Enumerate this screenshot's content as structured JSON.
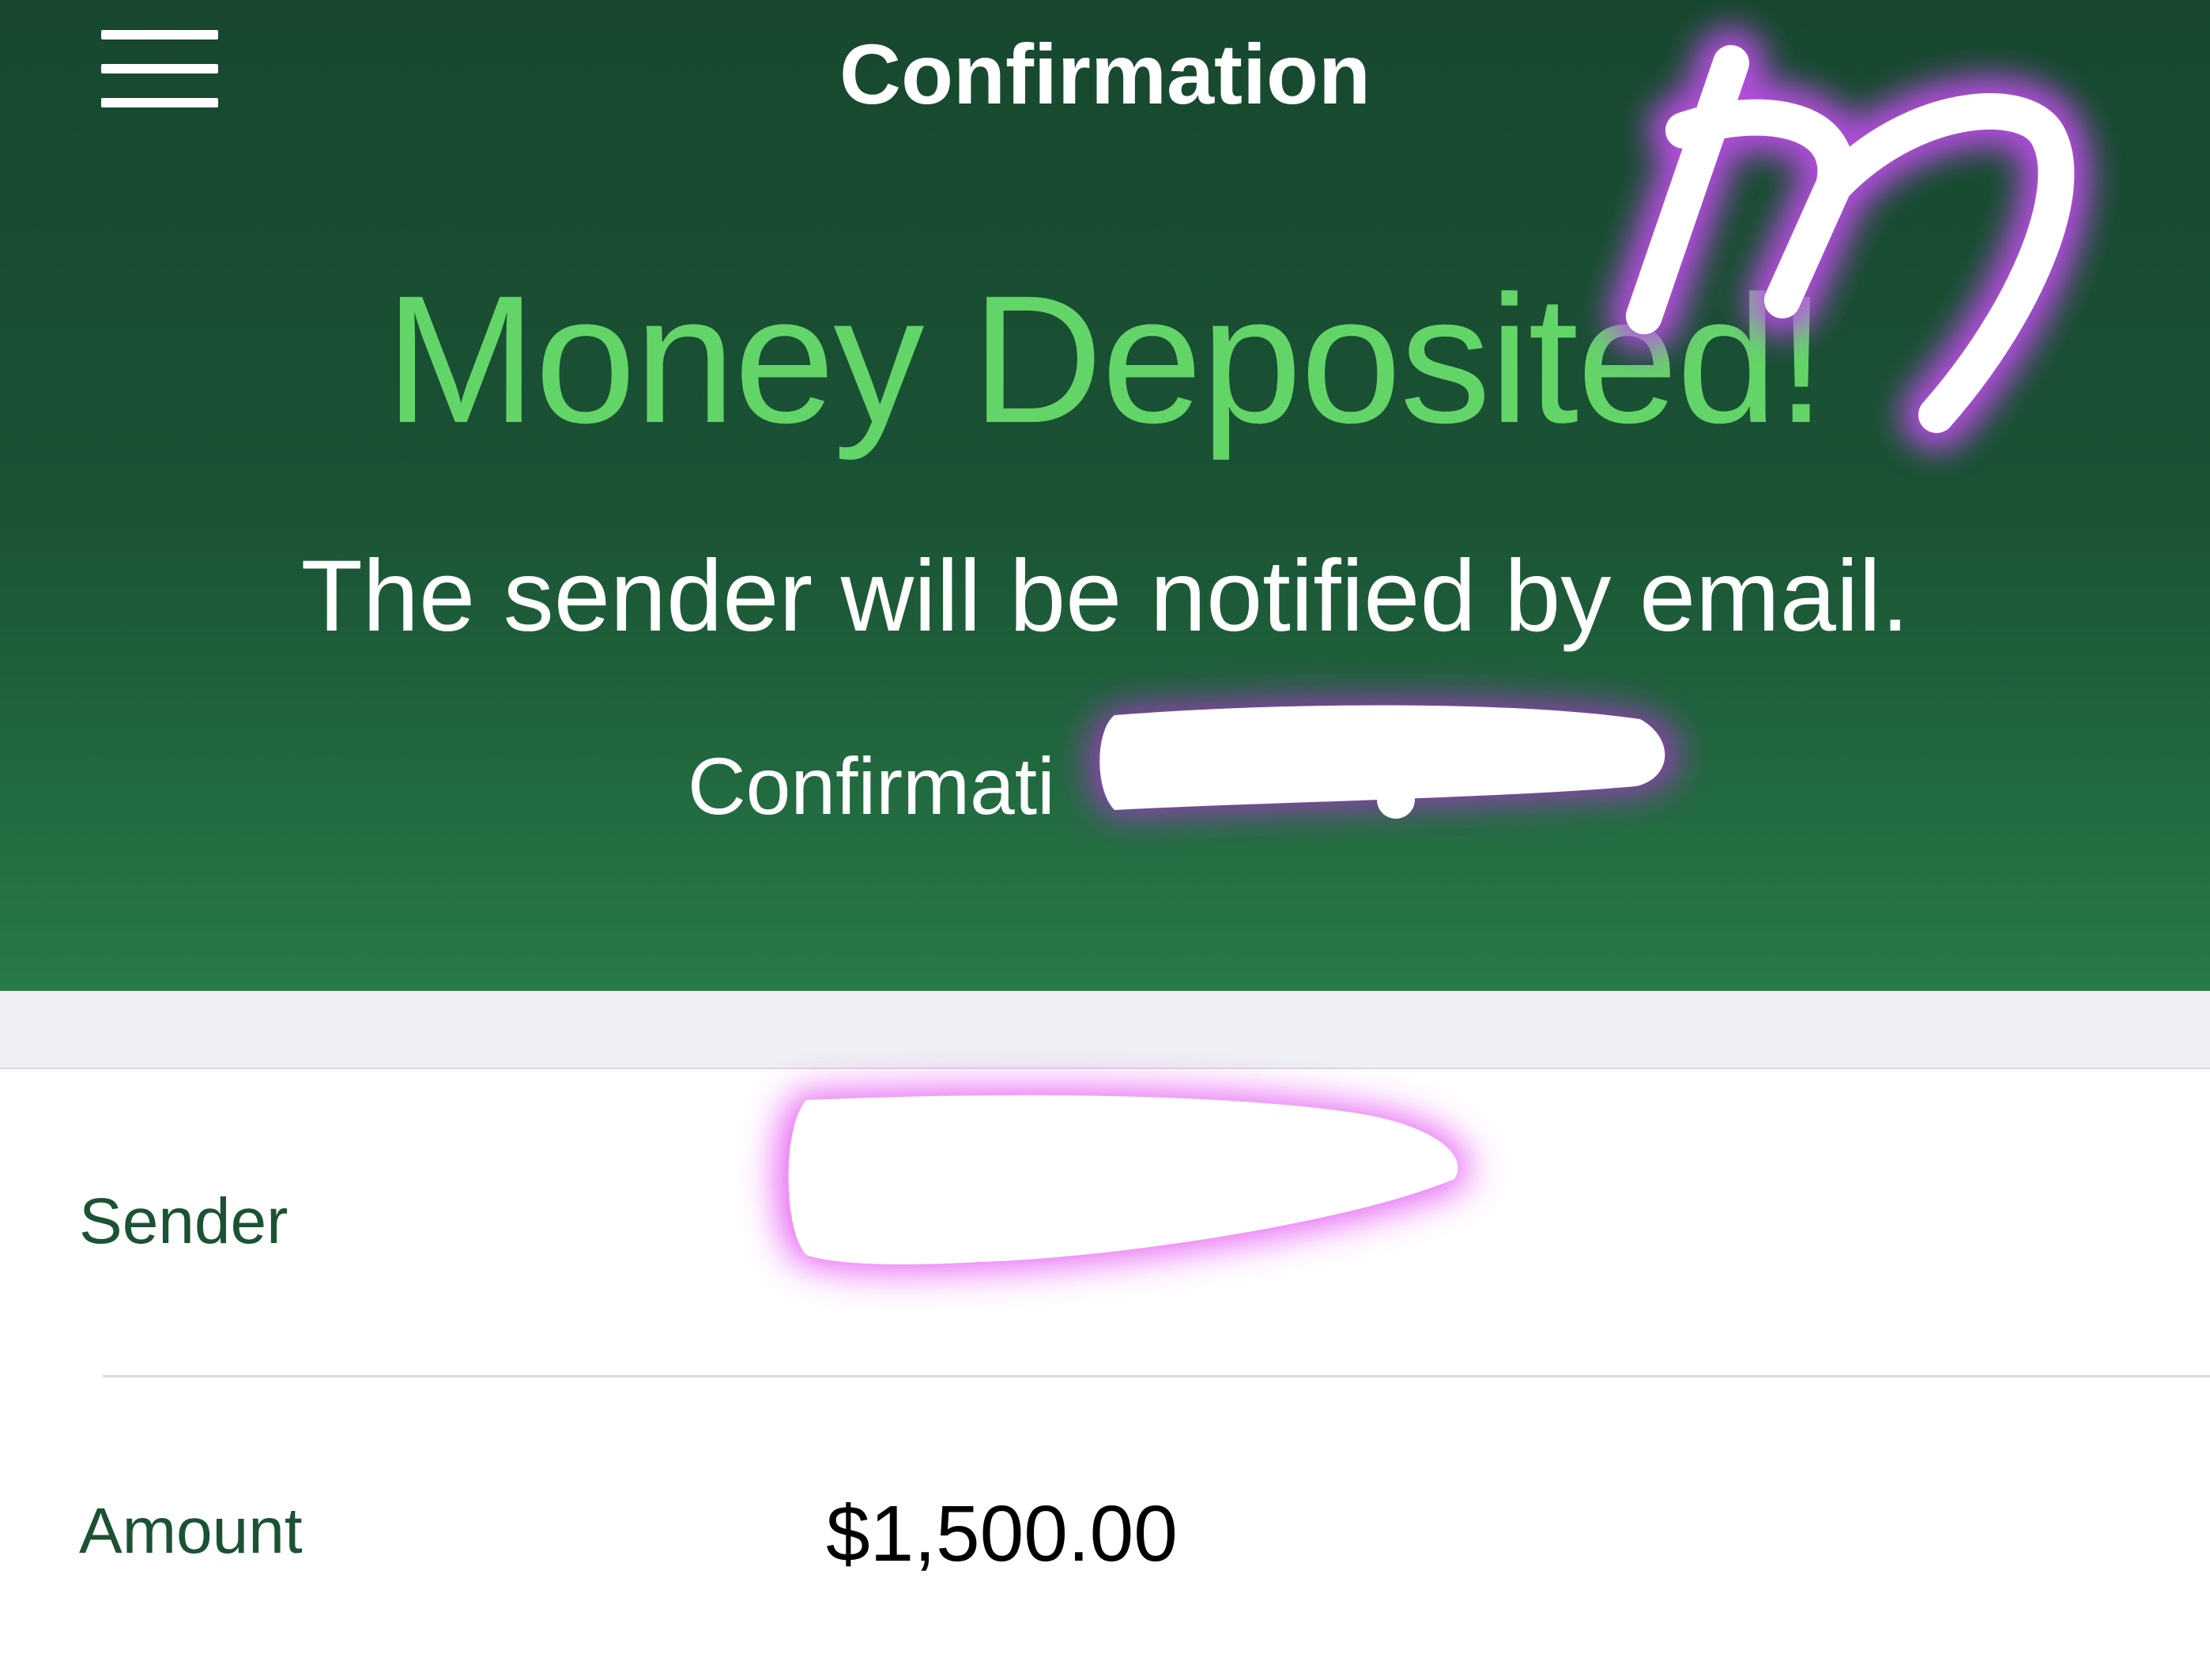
{
  "header": {
    "title": "Confirmation",
    "menu_icon": "hamburger-menu-icon"
  },
  "hero": {
    "headline": "Money Deposited!",
    "message": "The sender will be notified by email.",
    "confirmation_prefix": "Confirmati"
  },
  "details": {
    "rows": [
      {
        "label": "Sender",
        "value": ""
      },
      {
        "label": "Amount",
        "value": "$1,500.00"
      }
    ]
  },
  "colors": {
    "hero_top": "#17482f",
    "hero_bottom": "#287a48",
    "headline": "#63d468",
    "label": "#1c5234",
    "redaction_glow": "#cc33ff"
  }
}
